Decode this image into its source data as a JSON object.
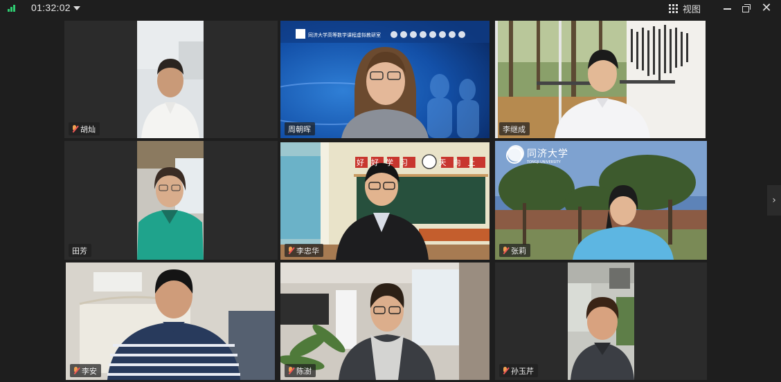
{
  "topbar": {
    "timer": "01:32:02",
    "view_label": "视图"
  },
  "colors": {
    "background": "#1e1e1e",
    "tile_background": "#2b2b2b",
    "signal": "#2ecc71",
    "mic_muted": "#f0a050"
  },
  "participants": [
    {
      "name": "胡灿",
      "muted": true
    },
    {
      "name": "周朝晖",
      "muted": false
    },
    {
      "name": "李继成",
      "muted": false
    },
    {
      "name": "田芳",
      "muted": false
    },
    {
      "name": "李忠华",
      "muted": true
    },
    {
      "name": "张莉",
      "muted": true
    },
    {
      "name": "李安",
      "muted": true
    },
    {
      "name": "陈澍",
      "muted": true
    },
    {
      "name": "孙玉芹",
      "muted": true
    }
  ],
  "backgrounds": {
    "tongji_logo_text": "同济大学",
    "tongji_logo_sub": "TONGJI UNIVERSITY",
    "banner_text": "同济大学高等数学课程虚拟教研室",
    "classroom_slogan": "好好学习 天天向上"
  }
}
